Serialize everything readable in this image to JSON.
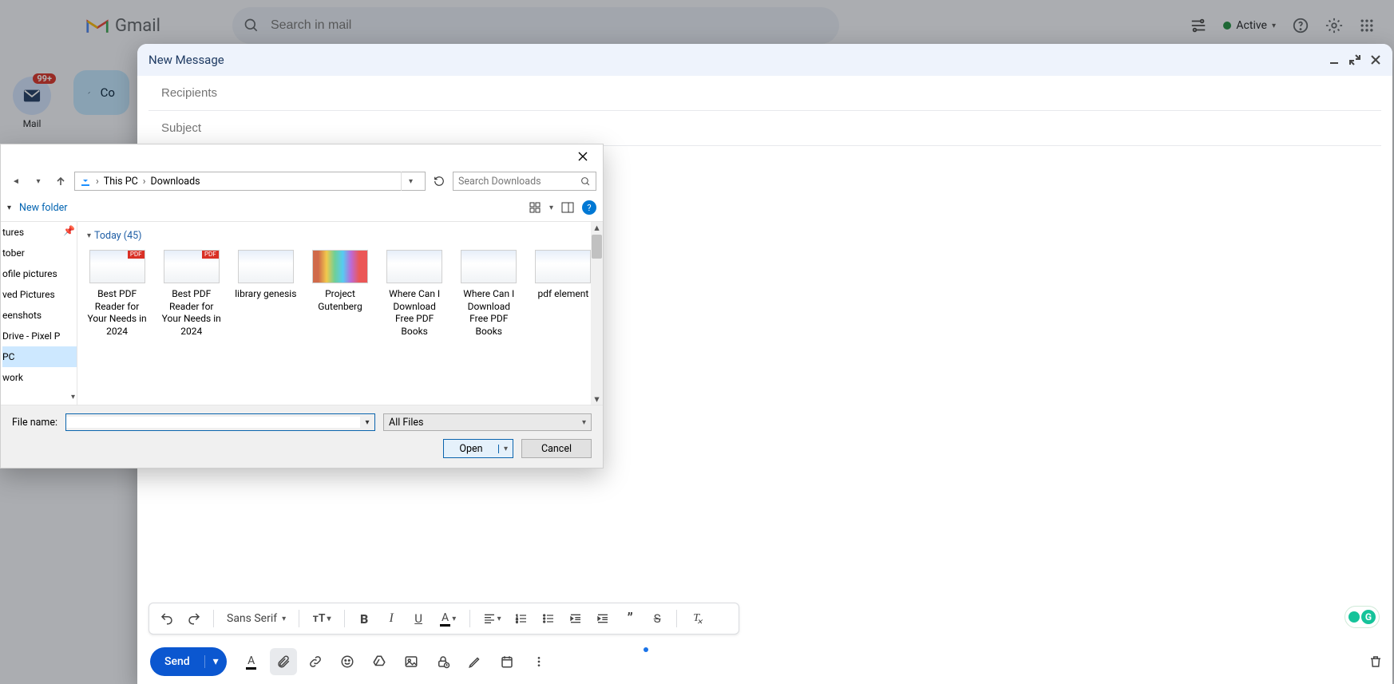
{
  "header": {
    "product": "Gmail",
    "search_placeholder": "Search in mail",
    "status": "Active"
  },
  "left_rail": {
    "mail_label": "Mail",
    "mail_badge": "99+"
  },
  "compose_button": "Co",
  "compose": {
    "title": "New Message",
    "recipients_placeholder": "Recipients",
    "subject_placeholder": "Subject",
    "font": "Sans Serif",
    "send": "Send"
  },
  "dialog": {
    "breadcrumb": {
      "root": "This PC",
      "folder": "Downloads"
    },
    "search_placeholder": "Search Downloads",
    "new_folder": "New folder",
    "group": "Today (45)",
    "side_items": [
      "tures",
      "tober",
      "ofile pictures",
      "ved Pictures",
      "eenshots",
      "Drive - Pixel P",
      "PC",
      "work"
    ],
    "side_selected_index": 6,
    "files": [
      {
        "name": "Best PDF Reader for Your Needs in 2024",
        "thumb": "pdf"
      },
      {
        "name": "Best PDF Reader for Your Needs in 2024",
        "thumb": "pdf"
      },
      {
        "name": "library genesis",
        "thumb": "site"
      },
      {
        "name": "Project Gutenberg",
        "thumb": "books"
      },
      {
        "name": "Where Can I Download Free PDF Books",
        "thumb": "site"
      },
      {
        "name": "Where Can I Download Free PDF Books",
        "thumb": "site"
      },
      {
        "name": "pdf element",
        "thumb": "site"
      }
    ],
    "filename_label": "File name:",
    "file_type": "All Files",
    "open": "Open",
    "cancel": "Cancel"
  }
}
